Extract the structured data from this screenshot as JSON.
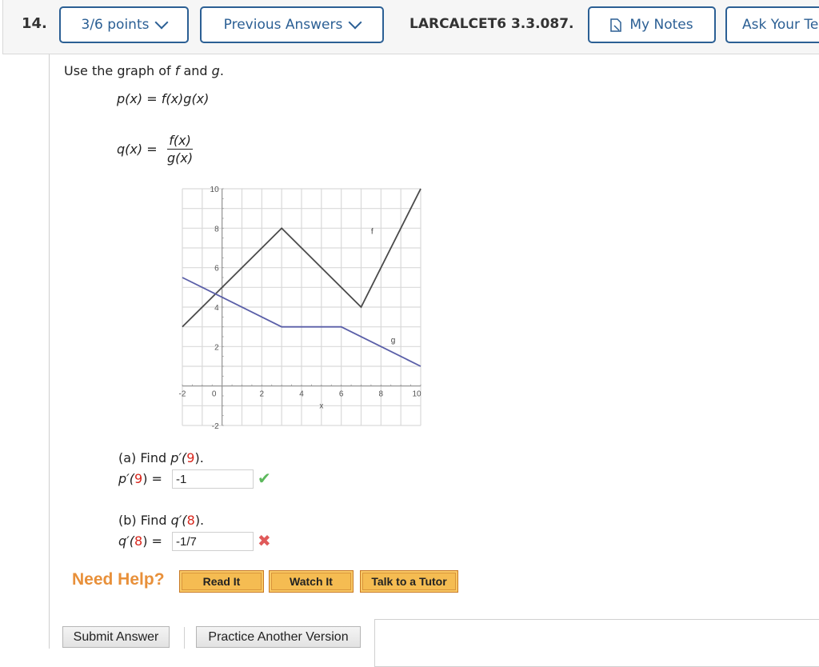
{
  "header": {
    "question_number": "14.",
    "points_button": "3/6 points",
    "previous_answers_button": "Previous Answers",
    "problem_code": "LARCALCET6 3.3.087.",
    "my_notes_button": "My Notes",
    "ask_teacher_button": "Ask Your Teacher"
  },
  "problem": {
    "intro_prefix": "Use the graph of ",
    "intro_f": "f",
    "intro_and": " and ",
    "intro_g": "g",
    "intro_suffix": ".",
    "p_def_lhs": "p(x)",
    "p_def_rhs": "= f(x)g(x)",
    "q_def_lhs": "q(x) =",
    "q_def_num": "f(x)",
    "q_def_den": "g(x)"
  },
  "chart_data": {
    "type": "line",
    "title": "",
    "xlabel": "x",
    "ylabel": "",
    "xlim": [
      -2,
      10
    ],
    "ylim": [
      -2,
      10
    ],
    "grid": true,
    "x_ticks": [
      "-2",
      "0",
      "2",
      "4",
      "6",
      "8",
      "10"
    ],
    "y_ticks": [
      "-2",
      "2",
      "4",
      "6",
      "8",
      "10"
    ],
    "series": [
      {
        "name": "f",
        "color": "#4a4a4a",
        "points": [
          [
            -2,
            3
          ],
          [
            3,
            8
          ],
          [
            7,
            4
          ],
          [
            10,
            10
          ]
        ],
        "label_at": [
          7.5,
          7.7
        ]
      },
      {
        "name": "g",
        "color": "#5a5fa8",
        "points": [
          [
            -2,
            5.5
          ],
          [
            3,
            3
          ],
          [
            6,
            3
          ],
          [
            10,
            1
          ]
        ],
        "label_at": [
          8.5,
          2.2
        ]
      }
    ]
  },
  "parts": [
    {
      "prompt_prefix": "(a) Find ",
      "func": "p′(",
      "arg": "9",
      "close": ").",
      "lhs_func": "p′(",
      "lhs_arg": "9",
      "lhs_close": ") =",
      "answer": "-1",
      "status": "correct",
      "status_icon": "✔"
    },
    {
      "prompt_prefix": "(b) Find ",
      "func": "q′(",
      "arg": "8",
      "close": ").",
      "lhs_func": "q′(",
      "lhs_arg": "8",
      "lhs_close": ") =",
      "answer": "-1/7",
      "status": "incorrect",
      "status_icon": "✖"
    }
  ],
  "help": {
    "label": "Need Help?",
    "read_it": "Read It",
    "watch_it": "Watch It",
    "talk_to_tutor": "Talk to a Tutor"
  },
  "actions": {
    "submit": "Submit Answer",
    "practice": "Practice Another Version"
  },
  "colors": {
    "accent": "#2b5f94",
    "help_orange": "#e8903a",
    "correct_green": "#5cb85c",
    "incorrect_red": "#e05a5a",
    "highlight_red": "#d9261c"
  }
}
